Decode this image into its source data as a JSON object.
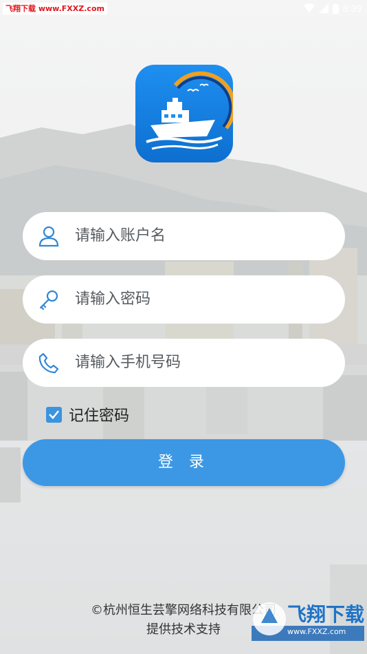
{
  "status_bar": {
    "watermark": "飞翔下载 www.FXXZ.com",
    "time": "8:39",
    "icons": [
      "wifi-icon",
      "signal-icon",
      "battery-icon"
    ]
  },
  "app": {
    "logo": "ship-logo-icon"
  },
  "form": {
    "account_placeholder": "请输入账户名",
    "password_placeholder": "请输入密码",
    "phone_placeholder": "请输入手机号码",
    "remember_label": "记住密码",
    "remember_checked": true,
    "login_label": "登 录"
  },
  "footer": {
    "line1": "©杭州恒生芸擎网络科技有限公司",
    "line2": "提供技术支持"
  },
  "badge": {
    "title": "飞翔下载",
    "url": "www.FXXZ.com"
  },
  "colors": {
    "accent": "#3c98e4",
    "icon": "#2f86d6",
    "field_bg": "#ffffff"
  }
}
